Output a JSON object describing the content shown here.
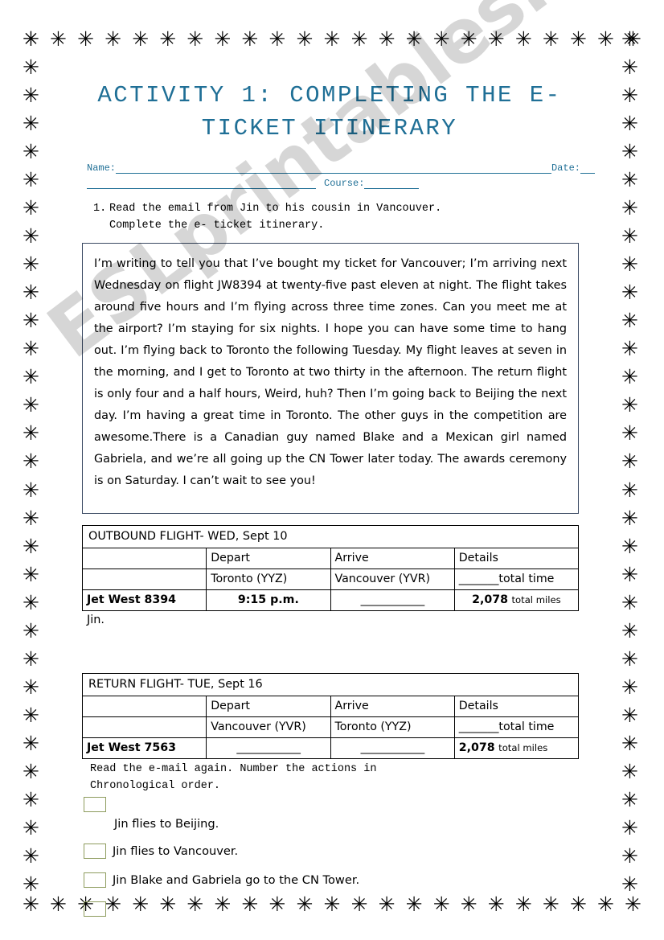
{
  "worksheet": {
    "title": "ACTIVITY 1: COMPLETING THE E-TICKET ITINERARY",
    "title_line1": "ACTIVITY 1: COMPLETING THE E-",
    "title_line2": "TICKET ITINERARY",
    "watermark": "ESLprintables.com",
    "border_glyph": "✳",
    "title_color": "#1f6f96",
    "checkbox_color": "#8e9c5e",
    "email_border_color": "#3b4a63"
  },
  "identity": {
    "name_label": "Name:",
    "date_label": "Date:",
    "course_label": "Course:"
  },
  "task1": {
    "number": "1.",
    "line1": "Read the email from Jin to his cousin in Vancouver.",
    "line2": "Complete the e- ticket itinerary."
  },
  "email": {
    "body": "I’m writing to tell you that I’ve bought my ticket for Vancouver; I’m arriving next Wednesday on flight JW8394 at twenty-five past eleven at night. The flight takes around five hours and I’m flying across three time zones. Can you meet me at the airport? I’m staying for six nights. I hope you can have some time to hang out. I’m flying back to Toronto the following Tuesday. My flight leaves at seven in the morning, and I get to Toronto at two thirty in the afternoon. The return flight is only four and a half hours, Weird, huh? Then I’m going back to Beijing the next day. I’m having a great time in Toronto. The other guys in the competition are awesome.There is a Canadian guy named Blake and a Mexican girl named Gabriela, and we’re all going up the CN Tower later today. The awards ceremony is on Saturday. I can’t wait to see you!",
    "signature": "Jin."
  },
  "outbound_table": {
    "title": "OUTBOUND FLIGHT- WED, Sept 10",
    "headers": [
      "",
      "Depart",
      "Arrive",
      "Details"
    ],
    "row_cities": [
      "",
      "Toronto (YYZ)",
      "Vancouver (YVR)",
      "_______total time"
    ],
    "row_flight": {
      "flight": "Jet West 8394",
      "depart": "9:15 p.m.",
      "arrive": "____________",
      "miles_value": "2,078",
      "miles_unit": "total miles"
    }
  },
  "return_table": {
    "title": "RETURN FLIGHT- TUE, Sept 16",
    "headers": [
      "",
      "Depart",
      "Arrive",
      "Details"
    ],
    "row_cities": [
      "",
      "Vancouver (YVR)",
      "Toronto (YYZ)",
      "_______total time"
    ],
    "row_flight": {
      "flight": "Jet West 7563",
      "depart": "____________",
      "arrive": "____________",
      "miles_value": "2,078",
      "miles_unit": "total miles"
    }
  },
  "task2": {
    "line1": "Read the e-mail again. Number the actions in",
    "line2": "Chronological order.",
    "items": [
      {
        "label": "Jin flies to Beijing."
      },
      {
        "label": "Jin flies to Vancouver."
      },
      {
        "label": "Jin Blake and Gabriela go to the CN Tower."
      },
      {
        "label": ""
      }
    ]
  }
}
